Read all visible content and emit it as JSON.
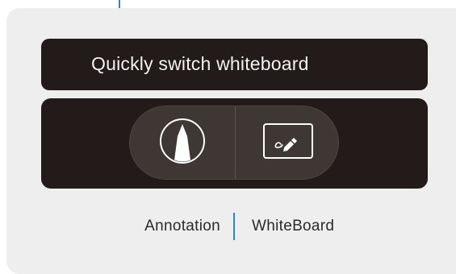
{
  "accent_color": "#2d86cd",
  "banner": {
    "text": "Quickly switch whiteboard"
  },
  "toggle": {
    "left_icon": "pen-nib-icon",
    "right_icon": "whiteboard-icon"
  },
  "labels": {
    "left": "Annotation",
    "right": "WhiteBoard"
  }
}
